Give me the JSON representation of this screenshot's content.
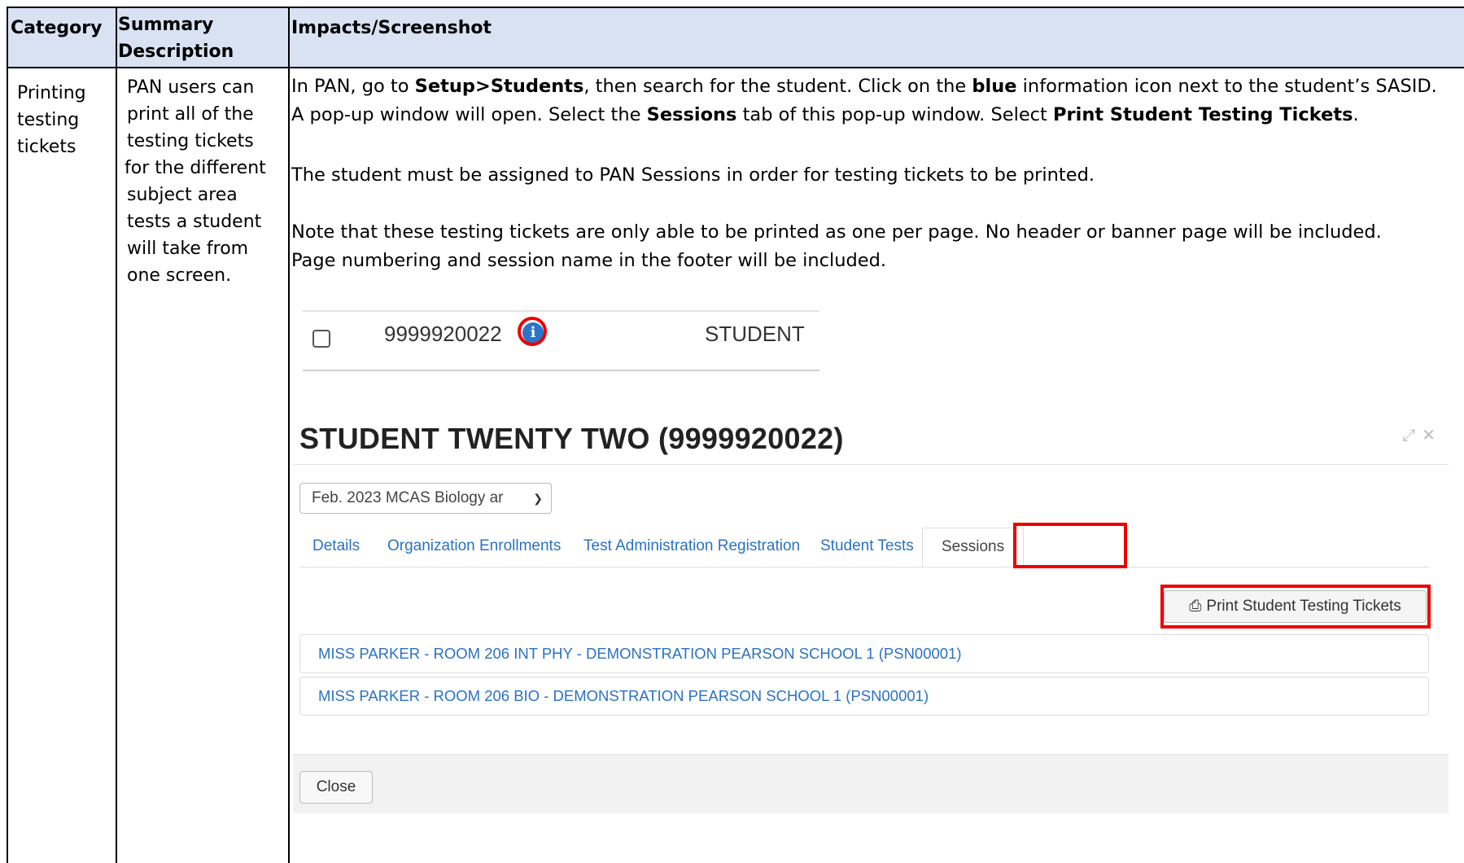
{
  "table": {
    "headers": {
      "category": "Category",
      "summary_line1": "Summary",
      "summary_line2": "Description",
      "impacts": "Impacts/Screenshot"
    },
    "row": {
      "category_lines": [
        "Printing",
        "testing",
        "tickets"
      ],
      "summary_lines": [
        "PAN users can",
        "print all of the",
        "testing tickets",
        "for the different",
        "subject area",
        "tests a student",
        "will take from",
        "one screen."
      ],
      "impacts": {
        "p1": {
          "a": "In PAN, go to ",
          "b1": "Setup>Students",
          "c": ", then search for the student. Click on the ",
          "b2": "blue",
          "d": " information icon next to the student’s SASID. A pop-up window will open. Select the ",
          "b3": "Sessions",
          "e": " tab of this pop-up window. Select ",
          "b4": "Print Student Testing Tickets",
          "f": "."
        },
        "p2": "The student must be assigned to PAN Sessions in order for testing tickets to be printed.",
        "p3_line1": "Note that these testing tickets are only able to be printed as one per page. No header or banner page will be included.",
        "p3_line2": "Page numbering and session name in the footer will be included."
      }
    }
  },
  "screenshot1": {
    "sasid": "9999920022",
    "info_icon": "info-icon",
    "name": "STUDENT"
  },
  "modal": {
    "title": "STUDENT TWENTY TWO (9999920022)",
    "controls": {
      "expand": "⤢",
      "close": "✕"
    },
    "select_value": "Feb. 2023 MCAS Biology ar",
    "tabs": [
      "Details",
      "Organization Enrollments",
      "Test Administration Registration",
      "Student Tests",
      "Sessions"
    ],
    "active_tab": "Sessions",
    "print_button": "Print Student Testing Tickets",
    "sessions": [
      "MISS PARKER - ROOM 206 INT PHY - DEMONSTRATION PEARSON SCHOOL 1 (PSN00001)",
      "MISS PARKER - ROOM 206 BIO - DEMONSTRATION PEARSON SCHOOL 1 (PSN00001)"
    ],
    "close_button": "Close"
  },
  "colors": {
    "header_bg": "#d9e2f3",
    "highlight": "#e00000",
    "link": "#2a72c4"
  }
}
